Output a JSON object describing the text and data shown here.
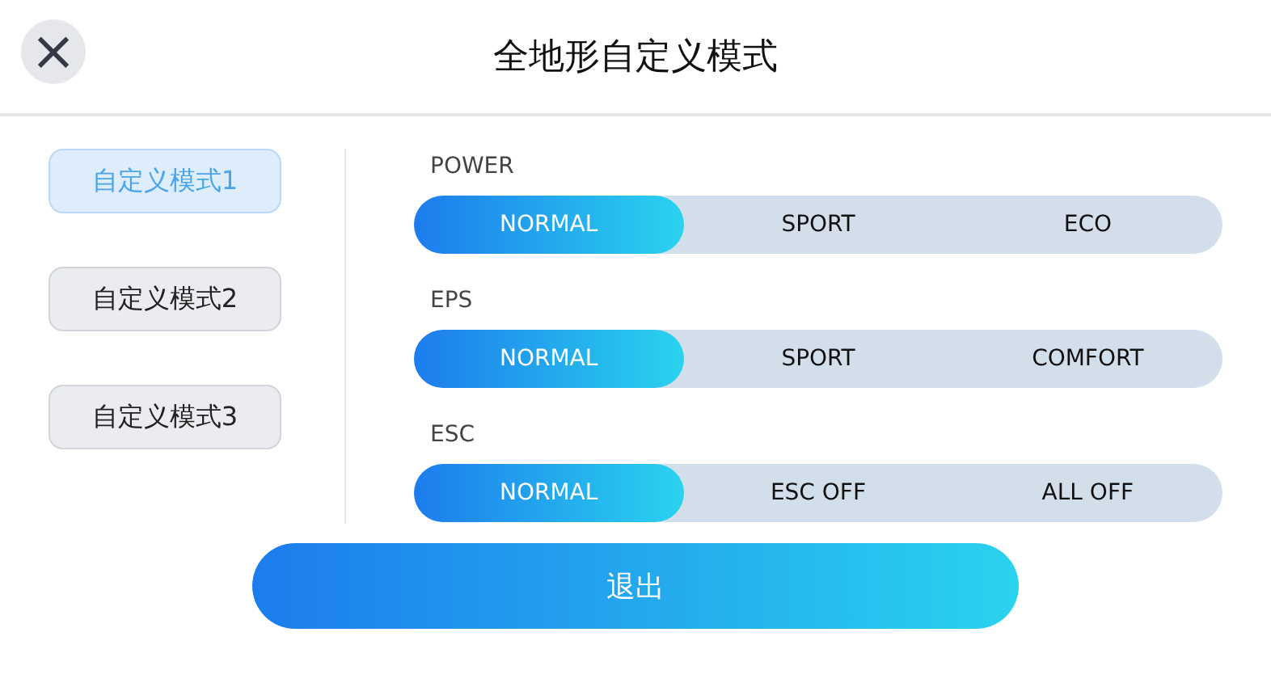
{
  "header": {
    "close": "×",
    "title": "全地形自定义模式"
  },
  "modes": [
    {
      "label": "自定义模式1",
      "selected": true
    },
    {
      "label": "自定义模式2",
      "selected": false
    },
    {
      "label": "自定义模式3",
      "selected": false
    }
  ],
  "settings": [
    {
      "label": "POWER",
      "options": [
        {
          "label": "NORMAL",
          "selected": true
        },
        {
          "label": "SPORT",
          "selected": false
        },
        {
          "label": "ECO",
          "selected": false
        }
      ]
    },
    {
      "label": "EPS",
      "options": [
        {
          "label": "NORMAL",
          "selected": true
        },
        {
          "label": "SPORT",
          "selected": false
        },
        {
          "label": "COMFORT",
          "selected": false
        }
      ]
    },
    {
      "label": "ESC",
      "options": [
        {
          "label": "NORMAL",
          "selected": true
        },
        {
          "label": "ESC OFF",
          "selected": false
        },
        {
          "label": "ALL OFF",
          "selected": false
        }
      ]
    }
  ],
  "exit_button": "退出"
}
